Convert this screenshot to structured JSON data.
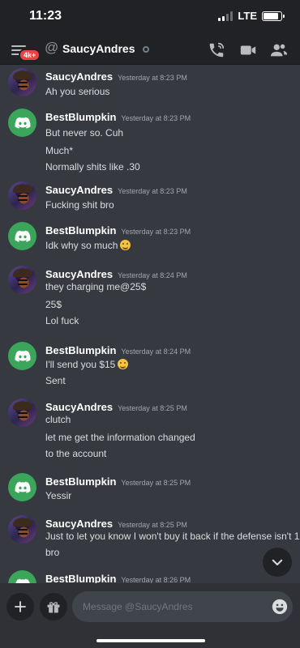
{
  "status": {
    "time": "11:23",
    "network": "LTE",
    "battery_level": 0.88
  },
  "header": {
    "title": "SaucyAndres",
    "badge": "4k+"
  },
  "messages": [
    {
      "author": "SaucyAndres",
      "time": "Yesterday at 8:23 PM",
      "avatar": "sauce",
      "lines": [
        "Ah you serious"
      ]
    },
    {
      "author": "BestBlumpkin",
      "time": "Yesterday at 8:23 PM",
      "avatar": "discord",
      "lines": [
        "But never so. Cuh",
        "Much*",
        "Normally shits like .30"
      ]
    },
    {
      "author": "SaucyAndres",
      "time": "Yesterday at 8:23 PM",
      "avatar": "sauce",
      "lines": [
        "Fucking shit bro"
      ]
    },
    {
      "author": "BestBlumpkin",
      "time": "Yesterday at 8:23 PM",
      "avatar": "discord",
      "lines": [
        "Idk why so much"
      ]
    },
    {
      "author": "SaucyAndres",
      "time": "Yesterday at 8:24 PM",
      "avatar": "sauce",
      "lines": [
        "they charging me@25$",
        "25$",
        "Lol fuck"
      ]
    },
    {
      "author": "BestBlumpkin",
      "time": "Yesterday at 8:24 PM",
      "avatar": "discord",
      "lines": [
        "I'll send you $15",
        "Sent"
      ]
    },
    {
      "author": "SaucyAndres",
      "time": "Yesterday at 8:25 PM",
      "avatar": "sauce",
      "lines": [
        "clutch",
        "let me get the information changed",
        "to the account"
      ]
    },
    {
      "author": "BestBlumpkin",
      "time": "Yesterday at 8:25 PM",
      "avatar": "discord",
      "lines": [
        "Yessir"
      ]
    },
    {
      "author": "SaucyAndres",
      "time": "Yesterday at 8:25 PM",
      "avatar": "sauce",
      "lines": [
        "Just to let you know I won't buy it back if the defense isn't 1",
        "bro"
      ]
    },
    {
      "author": "BestBlumpkin",
      "time": "Yesterday at 8:26 PM",
      "avatar": "discord",
      "lines": []
    }
  ],
  "composer": {
    "placeholder": "Message @SaucyAndres"
  },
  "icons": {
    "menu": "menu-icon",
    "at": "at-icon",
    "call": "phone-call-icon",
    "video": "video-camera-icon",
    "members": "members-icon",
    "add": "plus-icon",
    "gift": "gift-icon",
    "emoji": "emoji-icon",
    "scroll": "chevron-down-icon",
    "discord": "discord-logo-icon",
    "tear_smile": "smiling-face-with-tear-emoji"
  },
  "colors": {
    "background": "#36393f",
    "header": "#202225",
    "accent": "#3ba55c",
    "badge": "#ed4245",
    "text": "#dcddde"
  }
}
